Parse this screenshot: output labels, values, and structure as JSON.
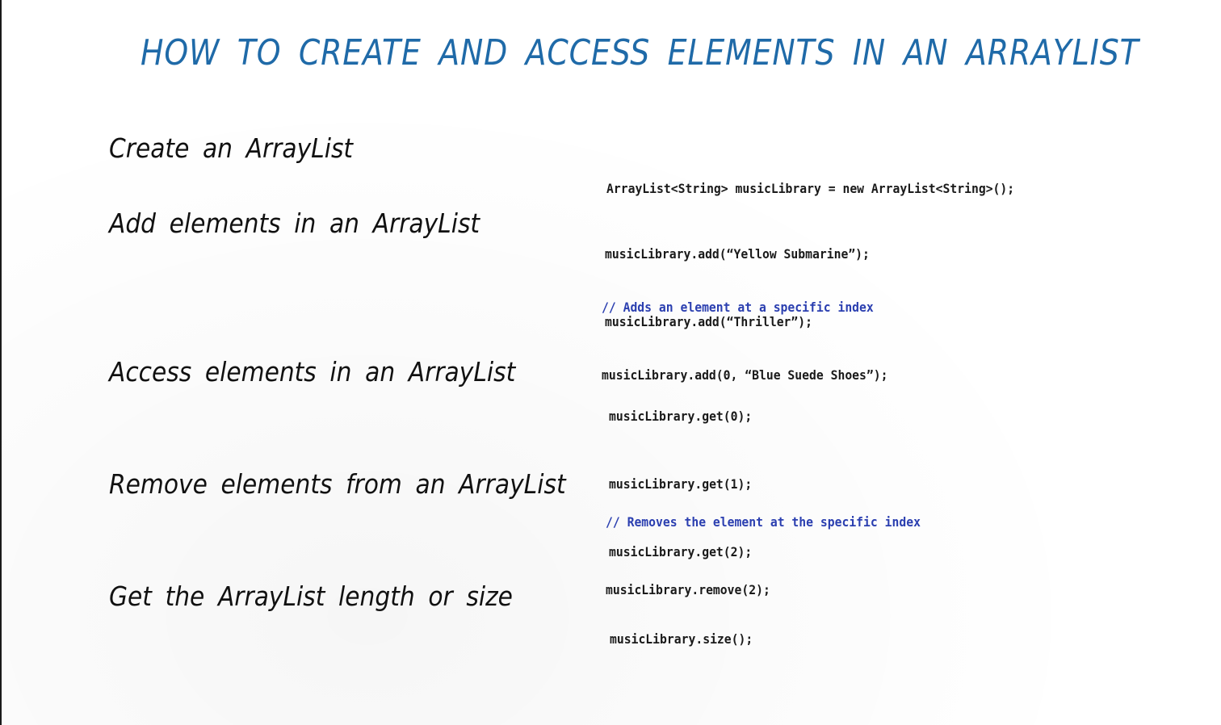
{
  "title": "HOW TO CREATE AND ACCESS ELEMENTS IN AN ARRAYLIST",
  "colors": {
    "title": "#1f6aa8",
    "comment": "#2b3fb0",
    "text": "#111111"
  },
  "sections": {
    "create": {
      "label": "Create an ArrayList",
      "code": [
        "ArrayList<String> musicLibrary = new ArrayList<String>();"
      ]
    },
    "add": {
      "label": "Add elements in an ArrayList",
      "code": [
        "musicLibrary.add(“Yellow Submarine”);",
        "musicLibrary.add(“Thriller”);"
      ],
      "comment": "// Adds an element at a specific index",
      "code_after": "musicLibrary.add(0, “Blue Suede Shoes”);"
    },
    "access": {
      "label": "Access elements in an ArrayList",
      "code": [
        "musicLibrary.get(0);",
        "musicLibrary.get(1);",
        "musicLibrary.get(2);"
      ]
    },
    "remove": {
      "label": "Remove elements from an ArrayList",
      "comment": "// Removes the element at the specific index",
      "code": [
        "musicLibrary.remove(2);"
      ]
    },
    "size": {
      "label": "Get the ArrayList length or size",
      "code": [
        "musicLibrary.size();"
      ]
    }
  }
}
